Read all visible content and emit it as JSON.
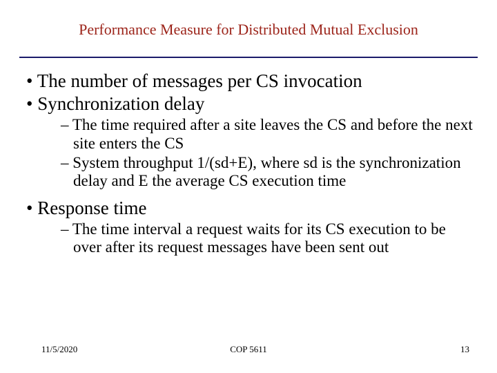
{
  "colors": {
    "title": "#9c241a",
    "divider": "#1a1a6a",
    "body": "#000000"
  },
  "title": "Performance Measure for Distributed Mutual Exclusion",
  "bullets": {
    "b1": "The number of messages per CS invocation",
    "b2": "Synchronization delay",
    "b2_sub1": "The time required after a site leaves the CS and before the next site enters the CS",
    "b2_sub2": "System throughput 1/(sd+E), where sd is the synchronization delay and E the average CS execution time",
    "b3": "Response time",
    "b3_sub1": "The time interval a request waits for its CS execution to be over after its request messages have been sent out"
  },
  "footer": {
    "date": "11/5/2020",
    "course": "COP 5611",
    "slide_number": "13"
  }
}
